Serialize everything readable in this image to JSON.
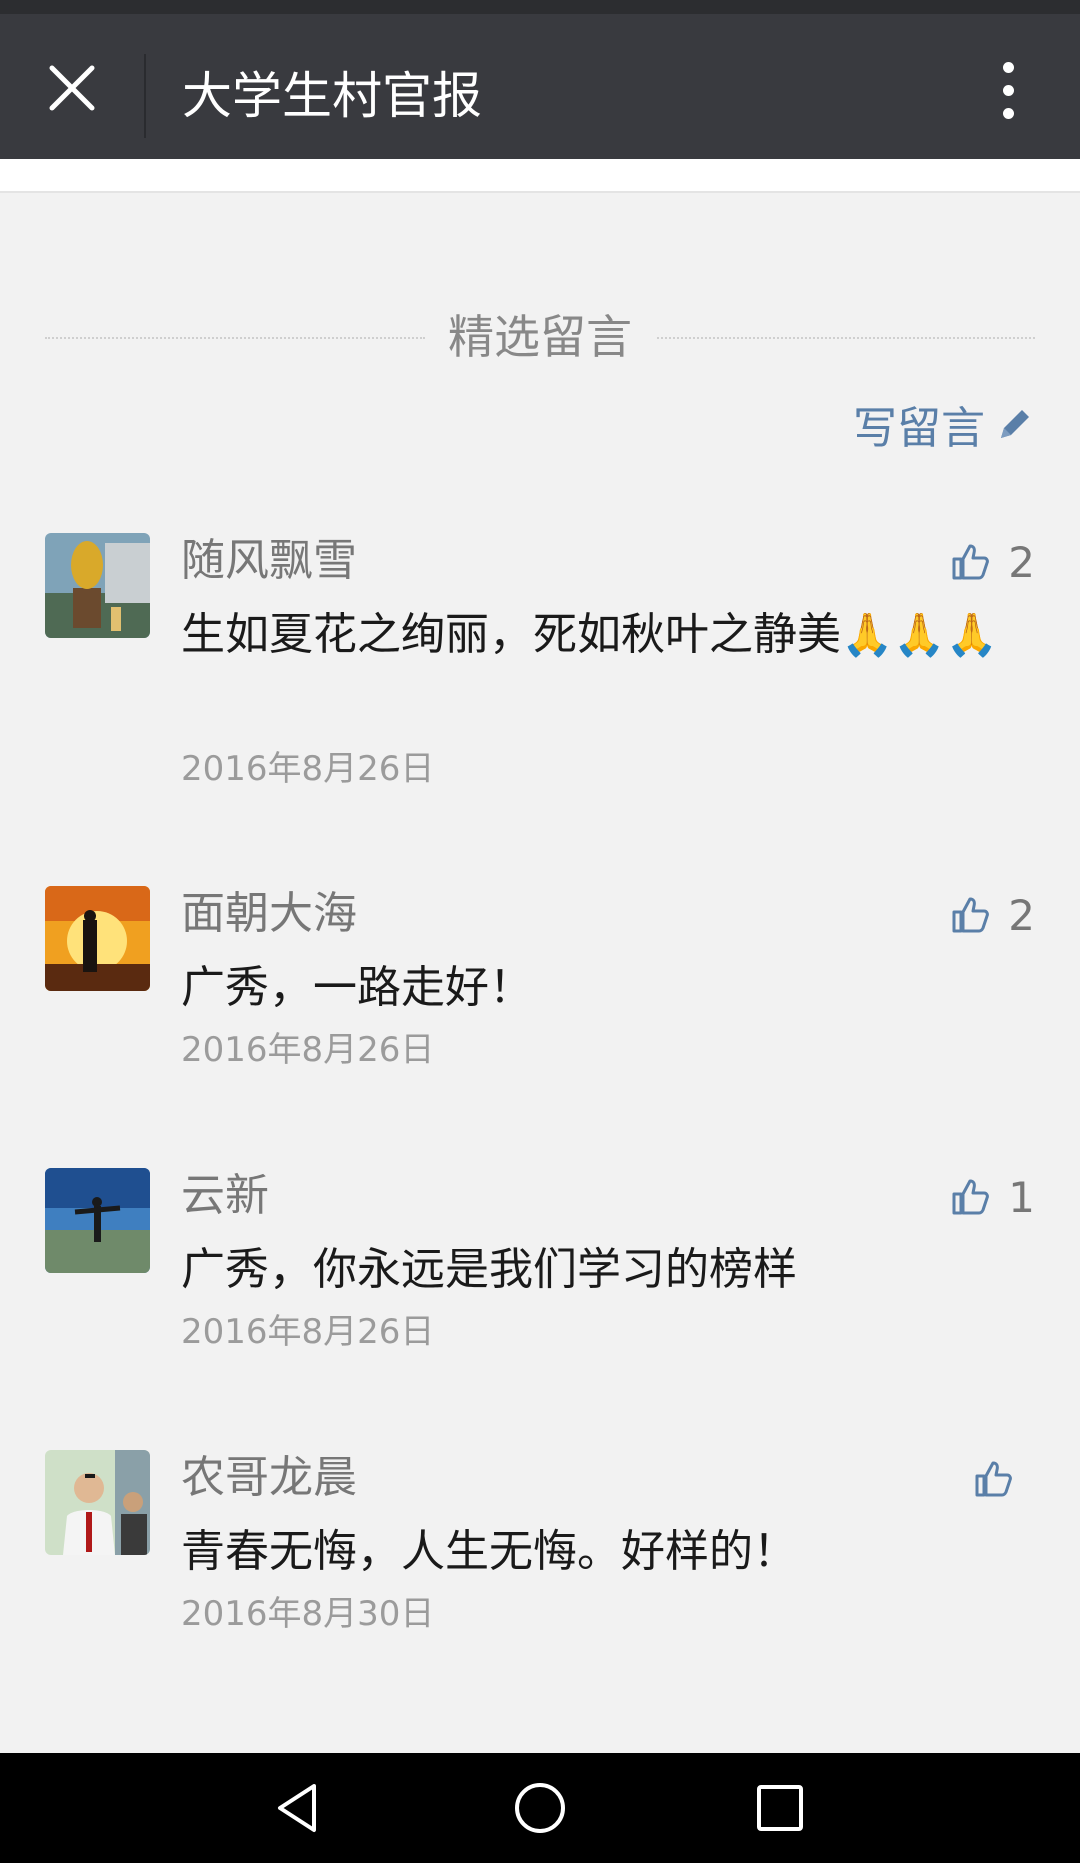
{
  "header": {
    "title": "大学生村官报",
    "close_icon": "close-icon",
    "more_icon": "more-vertical-icon"
  },
  "section": {
    "title": "精选留言",
    "write_label": "写留言",
    "write_icon": "pencil-icon"
  },
  "comments": [
    {
      "nickname": "随风飘雪",
      "content": "生如夏花之绚丽，死如秋叶之静美",
      "emoji": "🙏🙏🙏",
      "date": "2016年8月26日",
      "likes": "2"
    },
    {
      "nickname": "面朝大海",
      "content": "广秀，一路走好！",
      "date": "2016年8月26日",
      "likes": "2"
    },
    {
      "nickname": "云新",
      "content": "广秀，你永远是我们学习的榜样",
      "date": "2016年8月26日",
      "likes": "1"
    },
    {
      "nickname": "农哥龙晨",
      "content": "青春无悔，人生无悔。好样的！",
      "date": "2016年8月30日",
      "likes": ""
    }
  ],
  "navbar": {
    "back_icon": "back-triangle-icon",
    "home_icon": "home-circle-icon",
    "recents_icon": "recents-square-icon"
  },
  "colors": {
    "header_bg": "#393a3f",
    "page_bg": "#f2f2f2",
    "link": "#5a7fa8",
    "navbar_bg": "#000000"
  }
}
